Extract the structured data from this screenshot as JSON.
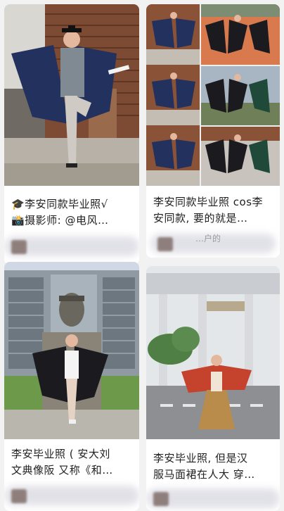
{
  "feed": {
    "cards": [
      {
        "title_lines": [
          "🎓李安同款毕业照√",
          "📸摄影师: @电风…"
        ],
        "image_description": "graduate in blue gown on one leg in front of brick water tower"
      },
      {
        "title_lines": [
          "李安同款毕业照 cos李",
          "安同款, 要的就是…"
        ],
        "author_partial": "…户的"
      },
      {
        "title_lines": [
          "李安毕业照 ( 安大刘",
          "文典像阪 又称《和…"
        ]
      },
      {
        "title_lines": [
          "李安毕业照, 但是汉",
          "服马面裙在人大 穿…"
        ]
      }
    ]
  },
  "colors": {
    "gown_blue": "#23315e",
    "gown_black": "#1b1b1f",
    "hanfu_red": "#c5432d",
    "hanfu_gold": "#b98c4b",
    "brick": "#8a4f35",
    "sky": "#cfd8e4"
  }
}
